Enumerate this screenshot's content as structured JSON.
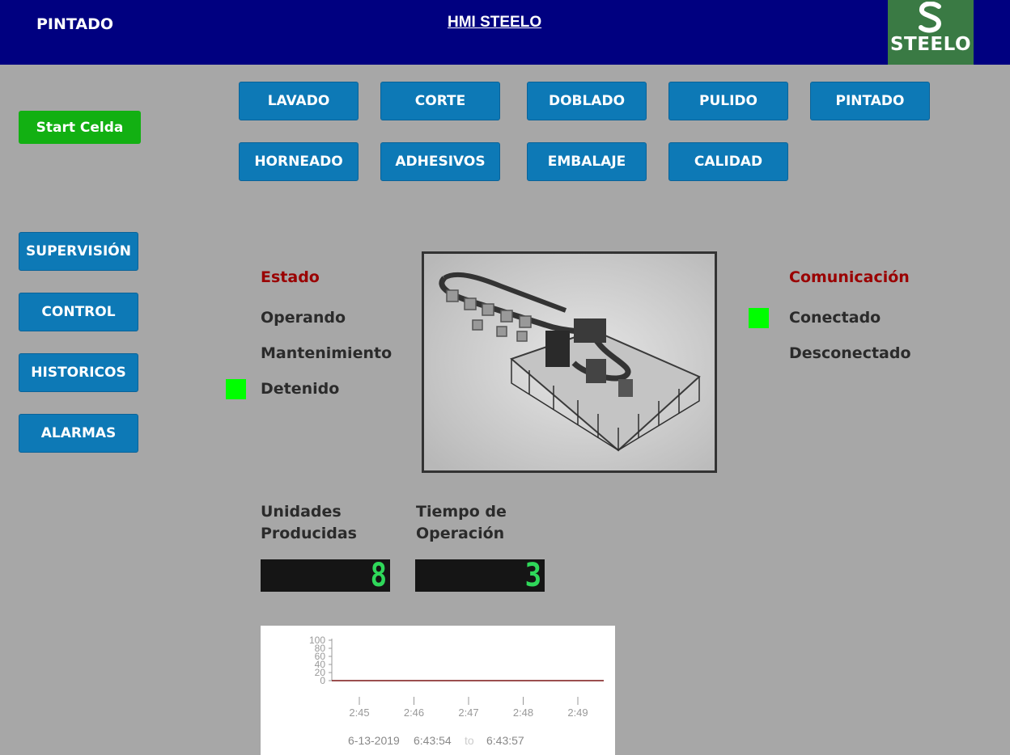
{
  "header": {
    "section": "PINTADO",
    "title": "HMI STEELO",
    "logo_text": "STEELO"
  },
  "start_button": "Start Celda",
  "process_buttons": [
    "LAVADO",
    "CORTE",
    "DOBLADO",
    "PULIDO",
    "PINTADO",
    "HORNEADO",
    "ADHESIVOS",
    "EMBALAJE",
    "CALIDAD"
  ],
  "nav_buttons": [
    "SUPERVISIÓN",
    "CONTROL",
    "HISTORICOS",
    "ALARMAS"
  ],
  "estado": {
    "title": "Estado",
    "items": [
      "Operando",
      "Mantenimiento",
      "Detenido"
    ],
    "active": "Detenido"
  },
  "comunicacion": {
    "title": "Comunicación",
    "items": [
      "Conectado",
      "Desconectado"
    ],
    "active": "Conectado"
  },
  "counters": {
    "units_label_1": "Unidades",
    "units_label_2": "Producidas",
    "units_value": "8",
    "time_label_1": "Tiempo de",
    "time_label_2": "Operación",
    "time_value": "3"
  },
  "chart_data": {
    "type": "line",
    "y_ticks": [
      "100",
      "80",
      "60",
      "40",
      "20",
      "0"
    ],
    "ylim": [
      0,
      100
    ],
    "x_ticks": [
      "2:45",
      "2:46",
      "2:47",
      "2:48",
      "2:49"
    ],
    "series": [
      {
        "values": [
          0,
          0,
          0,
          0,
          0,
          0
        ],
        "color": "#7a1515"
      }
    ],
    "footer": {
      "date": "6-13-2019",
      "start": "6:43:54",
      "separator": "to",
      "end": "6:43:57"
    }
  },
  "colors": {
    "header_bg": "#000080",
    "button": "#0d79b6",
    "start": "#12b012",
    "indicator_on": "#00ff00",
    "alert_text": "#9a0000"
  }
}
